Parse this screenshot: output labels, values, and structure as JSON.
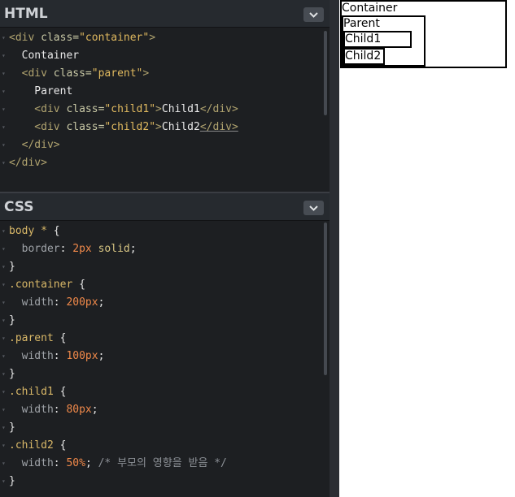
{
  "html_panel": {
    "title": "HTML",
    "lines": [
      {
        "fold": true,
        "tokens": [
          [
            "c-tag",
            "<div "
          ],
          [
            "c-attr",
            "class="
          ],
          [
            "c-str",
            "\"container\""
          ],
          [
            "c-tag",
            ">"
          ]
        ]
      },
      {
        "fold": false,
        "tokens": [
          [
            "c-text",
            "  Container"
          ]
        ]
      },
      {
        "fold": true,
        "tokens": [
          [
            "c-tag",
            "  <div "
          ],
          [
            "c-attr",
            "class="
          ],
          [
            "c-str",
            "\"parent\""
          ],
          [
            "c-tag",
            ">"
          ]
        ]
      },
      {
        "fold": false,
        "tokens": [
          [
            "c-text",
            "    Parent"
          ]
        ]
      },
      {
        "fold": false,
        "tokens": [
          [
            "c-tag",
            "    <div "
          ],
          [
            "c-attr",
            "class="
          ],
          [
            "c-str",
            "\"child1\""
          ],
          [
            "c-tag",
            ">"
          ],
          [
            "c-text",
            "Child1"
          ],
          [
            "c-tag",
            "</div>"
          ]
        ]
      },
      {
        "fold": false,
        "tokens": [
          [
            "c-tag",
            "    <div "
          ],
          [
            "c-attr",
            "class="
          ],
          [
            "c-str",
            "\"child2\""
          ],
          [
            "c-tag",
            ">"
          ],
          [
            "c-text",
            "Child2"
          ],
          [
            "c-tag underline",
            "</div>"
          ]
        ]
      },
      {
        "fold": false,
        "tokens": [
          [
            "c-tag",
            "  </div>"
          ]
        ]
      },
      {
        "fold": false,
        "tokens": [
          [
            "c-tag",
            "</div>"
          ]
        ]
      }
    ]
  },
  "css_panel": {
    "title": "CSS",
    "lines": [
      {
        "fold": true,
        "tokens": [
          [
            "c-sel",
            "body * "
          ],
          [
            "c-brace",
            "{"
          ]
        ]
      },
      {
        "fold": false,
        "tokens": [
          [
            "c-prop",
            "  border"
          ],
          [
            "c-brace",
            ": "
          ],
          [
            "c-num",
            "2px"
          ],
          [
            "c-kw",
            " solid"
          ],
          [
            "c-brace",
            ";"
          ]
        ]
      },
      {
        "fold": false,
        "tokens": [
          [
            "c-brace",
            "}"
          ]
        ]
      },
      {
        "fold": true,
        "tokens": [
          [
            "c-sel",
            ".container "
          ],
          [
            "c-brace",
            "{"
          ]
        ]
      },
      {
        "fold": false,
        "tokens": [
          [
            "c-prop",
            "  width"
          ],
          [
            "c-brace",
            ": "
          ],
          [
            "c-num",
            "200px"
          ],
          [
            "c-brace",
            ";"
          ]
        ]
      },
      {
        "fold": false,
        "tokens": [
          [
            "c-brace",
            "}"
          ]
        ]
      },
      {
        "fold": true,
        "tokens": [
          [
            "c-sel",
            ".parent "
          ],
          [
            "c-brace",
            "{"
          ]
        ]
      },
      {
        "fold": false,
        "tokens": [
          [
            "c-prop",
            "  width"
          ],
          [
            "c-brace",
            ": "
          ],
          [
            "c-num",
            "100px"
          ],
          [
            "c-brace",
            ";"
          ]
        ]
      },
      {
        "fold": false,
        "tokens": [
          [
            "c-brace",
            "}"
          ]
        ]
      },
      {
        "fold": true,
        "tokens": [
          [
            "c-sel",
            ".child1 "
          ],
          [
            "c-brace",
            "{"
          ]
        ]
      },
      {
        "fold": false,
        "tokens": [
          [
            "c-prop",
            "  width"
          ],
          [
            "c-brace",
            ": "
          ],
          [
            "c-num",
            "80px"
          ],
          [
            "c-brace",
            ";"
          ]
        ]
      },
      {
        "fold": false,
        "tokens": [
          [
            "c-brace",
            "}"
          ]
        ]
      },
      {
        "fold": true,
        "tokens": [
          [
            "c-sel",
            ".child2 "
          ],
          [
            "c-brace",
            "{"
          ]
        ]
      },
      {
        "fold": false,
        "tokens": [
          [
            "c-prop",
            "  width"
          ],
          [
            "c-brace",
            ": "
          ],
          [
            "c-num",
            "50%"
          ],
          [
            "c-brace",
            "; "
          ],
          [
            "c-comment",
            "/* 부모의 영향을 받음 */"
          ]
        ]
      },
      {
        "fold": false,
        "tokens": [
          [
            "c-brace",
            "}"
          ]
        ]
      }
    ]
  },
  "preview": {
    "container_text": "Container",
    "parent_text": "Parent",
    "child1_text": "Child1",
    "child2_text": "Child2"
  },
  "icons": {
    "collapse": "chevron-down-icon",
    "fold": "fold-triangle-icon"
  },
  "colors": {
    "editor_bg": "#1d1f22",
    "header_bg": "#262a2f",
    "button_bg": "#474c53",
    "tag": "#b0a36f",
    "string": "#e0b95f",
    "number": "#f0894a",
    "comment": "#8c9096"
  }
}
